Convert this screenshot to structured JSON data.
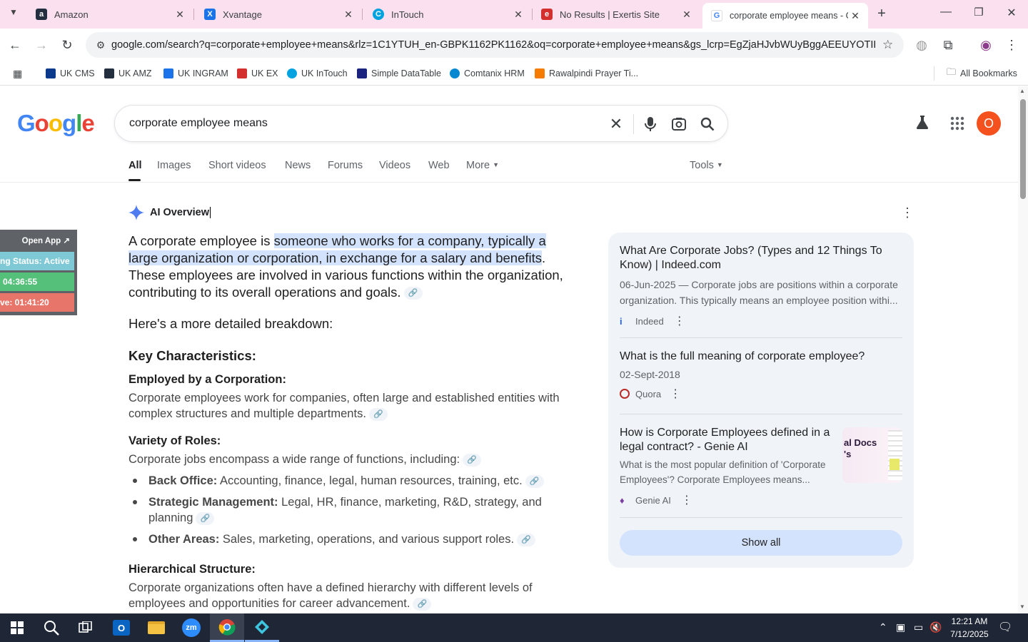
{
  "browser": {
    "tabs": [
      {
        "title": "Amazon",
        "favicon": "amazon-icon",
        "color": "#232f3e"
      },
      {
        "title": "Xvantage",
        "favicon": "xvantage-icon",
        "color": "#1a73e8"
      },
      {
        "title": "InTouch",
        "favicon": "intouch-icon",
        "color": "#00a3e0"
      },
      {
        "title": "No Results | Exertis Site",
        "favicon": "exertis-icon",
        "color": "#d32f2f"
      },
      {
        "title": "corporate employee means - G",
        "favicon": "google-icon",
        "color": "#4285f4",
        "active": true
      }
    ],
    "url": "google.com/search?q=corporate+employee+means&rlz=1C1YTUH_en-GBPK1162PK1162&oq=corporate+employee+means&gs_lcrp=EgZjaHJvbWUyBggAEEUYOTIHCAE...",
    "bookmarks": [
      {
        "label": "UK CMS",
        "color": "#0b3a8c"
      },
      {
        "label": "UK AMZ",
        "color": "#232f3e"
      },
      {
        "label": "UK INGRAM",
        "color": "#1a73e8"
      },
      {
        "label": "UK EX",
        "color": "#d32f2f"
      },
      {
        "label": "UK InTouch",
        "color": "#00a3e0"
      },
      {
        "label": "Simple DataTable",
        "color": "#1a237e"
      },
      {
        "label": "Comtanix HRM",
        "color": "#0288d1"
      },
      {
        "label": "Rawalpindi Prayer Ti...",
        "color": "#f57c00"
      }
    ],
    "all_bookmarks": "All Bookmarks"
  },
  "google": {
    "logo": "Google",
    "query": "corporate employee means",
    "avatar_letter": "O",
    "nav_tabs": [
      "All",
      "Images",
      "Short videos",
      "News",
      "Forums",
      "Videos",
      "Web",
      "More"
    ],
    "tools": "Tools"
  },
  "ai_overview": {
    "heading": "AI Overview",
    "intro_before": "A corporate employee is ",
    "intro_highlight": "someone who works for a company, typically a large organization or corporation, in exchange for a salary and benefits",
    "intro_after": ". These employees are involved in various functions within the organization, contributing to its overall operations and goals.",
    "breakdown": "Here's a more detailed breakdown:",
    "key_heading": "Key Characteristics:",
    "sections": [
      {
        "title": "Employed by a Corporation:",
        "text": "Corporate employees work for companies, often large and established entities with complex structures and multiple departments."
      },
      {
        "title": "Variety of Roles:",
        "text": "Corporate jobs encompass a wide range of functions, including:"
      },
      {
        "title": "Hierarchical Structure:",
        "text": "Corporate organizations often have a defined hierarchy with different levels of employees and opportunities for career advancement."
      }
    ],
    "bullets": [
      {
        "label": "Back Office:",
        "text": " Accounting, finance, legal, human resources, training, etc."
      },
      {
        "label": "Strategic Management:",
        "text": " Legal, HR, finance, marketing, R&D, strategy, and planning"
      },
      {
        "label": "Other Areas:",
        "text": " Sales, marketing, operations, and various support roles."
      }
    ]
  },
  "sources": [
    {
      "title": "What Are Corporate Jobs? (Types and 12 Things To Know) | Indeed.com",
      "desc": "06-Jun-2025 — Corporate jobs are positions within a corporate organization. This typically means an employee position withi...",
      "site": "Indeed"
    },
    {
      "title": "What is the full meaning of corporate employee?",
      "desc": "02-Sept-2018",
      "site": "Quora"
    },
    {
      "title": "How is Corporate Employees defined in a legal contract? - Genie AI",
      "desc": "What is the most popular definition of 'Corporate Employees'? Corporate Employees means...",
      "site": "Genie AI",
      "thumb_text": "al Docs 's"
    }
  ],
  "show_all": "Show all",
  "widget": {
    "open_app": "Open App ↗",
    "status": "ng Status: Active",
    "timer1": "04:36:55",
    "timer2": "ve: 01:41:20"
  },
  "taskbar": {
    "time": "12:21 AM",
    "date": "7/12/2025"
  }
}
